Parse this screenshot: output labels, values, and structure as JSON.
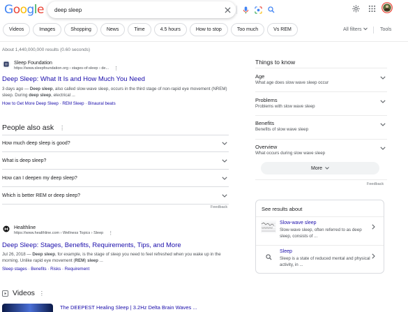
{
  "logo": {
    "letters": [
      "G",
      "o",
      "o",
      "g",
      "l",
      "e"
    ],
    "colors": [
      "#4285F4",
      "#EA4335",
      "#FBBC05",
      "#4285F4",
      "#34A853",
      "#EA4335"
    ]
  },
  "search": {
    "value": "deep sleep"
  },
  "chips": [
    "Videos",
    "Images",
    "Shopping",
    "News",
    "Time",
    "4.5 hours",
    "How to stop",
    "Too much",
    "Vs REM"
  ],
  "filters_label": "All filters",
  "tools_label": "Tools",
  "stats": "About 1,440,000,000 results (0.60 seconds)",
  "result1": {
    "site": "Sleep Foundation",
    "url": "https://www.sleepfoundation.org › stages-of-sleep › de...",
    "title": "Deep Sleep: What It Is and How Much You Need",
    "snippet_parts": [
      "3 days ago — ",
      "Deep sleep",
      ", also called slow-wave sleep, occurs in the third stage of non-rapid eye movement (NREM) sleep. During ",
      "deep sleep",
      ", electrical ..."
    ],
    "links": [
      "How to Get More Deep Sleep",
      "REM Sleep",
      "Binaural beats"
    ]
  },
  "paa": {
    "title": "People also ask",
    "questions": [
      "How much deep sleep is good?",
      "What is deep sleep?",
      "How can I deepen my deep sleep?",
      "Which is better REM or deep sleep?"
    ],
    "feedback": "Feedback"
  },
  "result2": {
    "site": "Healthline",
    "url": "https://www.healthline.com › Wellness Topics › Sleep",
    "title": "Deep Sleep: Stages, Benefits, Requirements, Tips, and More",
    "snippet_parts": [
      "Jul 26, 2018 — ",
      "Deep sleep",
      ", for example, is the stage of sleep you need to feel refreshed when you wake up in the morning. Unlike rapid eye movement (",
      "REM",
      ") ",
      "sleep",
      " ..."
    ],
    "links": [
      "Sleep stages",
      "Benefits",
      "Risks",
      "Requirement"
    ]
  },
  "videos": {
    "title": "Videos",
    "first_title": "The DEEPEST Healing Sleep | 3.2Hz Delta Brain Waves ..."
  },
  "things_to_know": {
    "title": "Things to know",
    "items": [
      {
        "heading": "Age",
        "sub": "What age does slow wave sleep occur"
      },
      {
        "heading": "Problems",
        "sub": "Problems with slow wave sleep"
      },
      {
        "heading": "Benefits",
        "sub": "Benefits of slow wave sleep"
      },
      {
        "heading": "Overview",
        "sub": "What occurs during slow wave sleep"
      }
    ],
    "more": "More",
    "feedback": "Feedback"
  },
  "see_results": {
    "title": "See results about",
    "items": [
      {
        "title": "Slow-wave sleep",
        "desc": "Slow-wave sleep, often referred to as deep sleep, consists of ..."
      },
      {
        "title": "Sleep",
        "desc": "Sleep is a state of reduced mental and physical activity, in ..."
      }
    ]
  }
}
